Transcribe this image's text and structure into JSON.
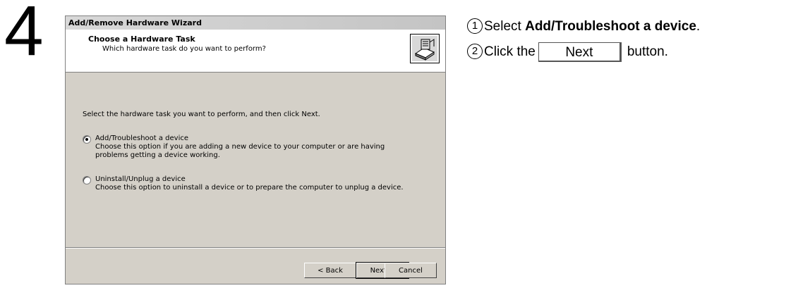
{
  "step_number": "4",
  "dialog": {
    "title": "Add/Remove Hardware Wizard",
    "header_title": "Choose a Hardware Task",
    "header_subtitle": "Which hardware task do you want to perform?",
    "icon": "hardware-wizard-icon",
    "prompt": "Select the hardware task you want to perform, and then click Next.",
    "options": [
      {
        "label": "Add/Troubleshoot a device",
        "description": "Choose this option if you are adding a new device to your computer or are having problems getting a device working.",
        "selected": true
      },
      {
        "label": "Uninstall/Unplug a device",
        "description": "Choose this option to uninstall a device or to prepare the computer to unplug a device.",
        "selected": false
      }
    ],
    "buttons": {
      "back": "< Back",
      "next": "Next >",
      "cancel": "Cancel"
    }
  },
  "instructions": {
    "step1_marker": "1",
    "step1_prefix": "Select ",
    "step1_bold": "Add/Troubleshoot a device",
    "step1_suffix": ".",
    "step2_marker": "2",
    "step2_prefix": "Click the",
    "step2_button": "Next",
    "step2_suffix": "button."
  }
}
